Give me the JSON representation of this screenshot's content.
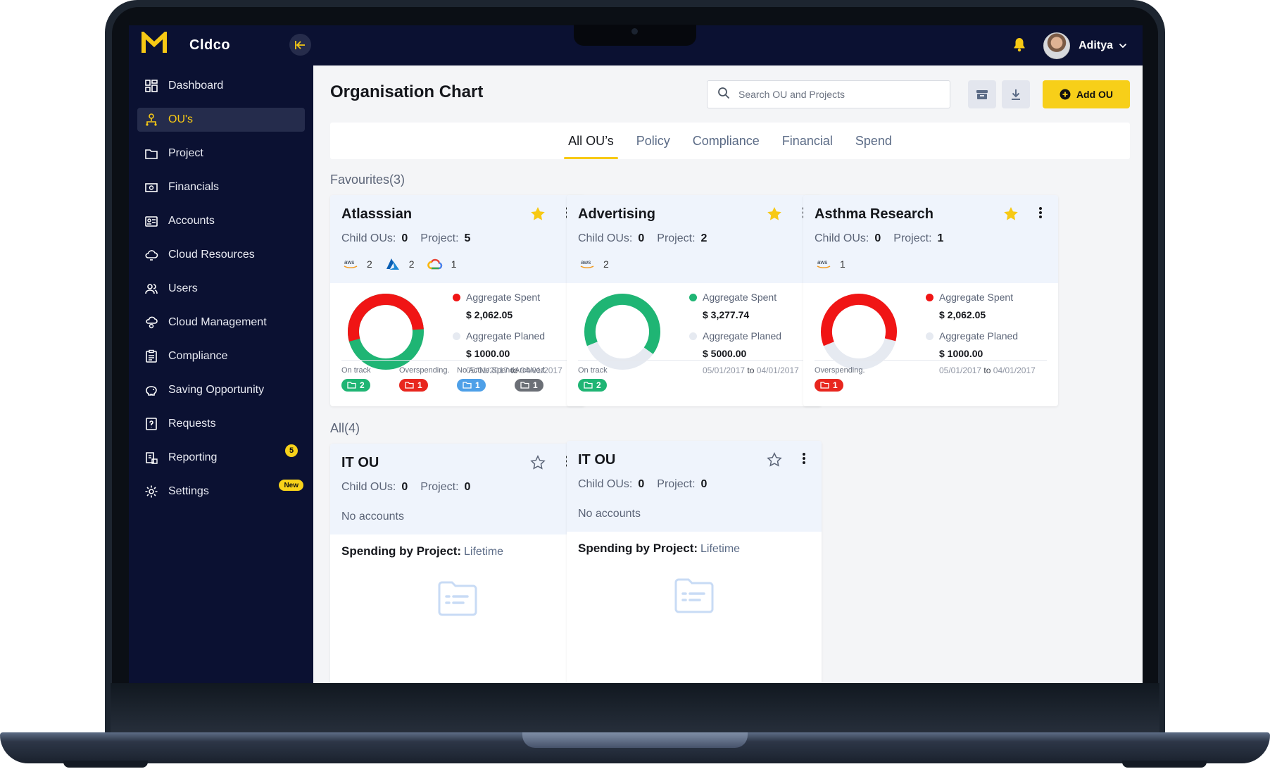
{
  "app": {
    "name": "Cldco",
    "user": "Aditya"
  },
  "nav": [
    {
      "label": "Dashboard",
      "icon": "dashboard-icon"
    },
    {
      "label": "OU's",
      "icon": "org-icon",
      "active": true
    },
    {
      "label": "Project",
      "icon": "folder-icon"
    },
    {
      "label": "Financials",
      "icon": "money-icon"
    },
    {
      "label": "Accounts",
      "icon": "accounts-icon"
    },
    {
      "label": "Cloud Resources",
      "icon": "cloud-icon"
    },
    {
      "label": "Users",
      "icon": "users-icon"
    },
    {
      "label": "Cloud Management",
      "icon": "cloud-gear-icon"
    },
    {
      "label": "Compliance",
      "icon": "clipboard-icon"
    },
    {
      "label": "Saving Opportunity",
      "icon": "piggy-icon"
    },
    {
      "label": "Requests",
      "icon": "request-icon"
    },
    {
      "label": "Reporting",
      "icon": "report-icon",
      "badge": "5"
    },
    {
      "label": "Settings",
      "icon": "gear-icon",
      "badge": "New"
    }
  ],
  "page": {
    "title": "Organisation Chart",
    "search_placeholder": "Search OU and Projects",
    "add_label": "Add OU",
    "tabs": [
      "All OU’s",
      "Policy",
      "Compliance",
      "Financial",
      "Spend"
    ],
    "favourites_label": "Favourites(3)",
    "all_label": "All(4)"
  },
  "labels": {
    "child_ous": "Child OUs:",
    "project": "Project:",
    "aggregate_spent": "Aggregate Spent",
    "aggregate_planed": "Aggregate Planed",
    "to": "to",
    "no_accounts": "No accounts",
    "spending_by_project": "Spending by Project:",
    "lifetime": "Lifetime"
  },
  "favourites": [
    {
      "name": "Atlasssian",
      "child_ous": "0",
      "projects": "5",
      "providers": [
        {
          "icon": "aws-icon",
          "count": "2"
        },
        {
          "icon": "azure-icon",
          "count": "2"
        },
        {
          "icon": "gcp-icon",
          "count": "1"
        }
      ],
      "spent": "$ 2,062.05",
      "planned": "$ 1000.00",
      "date_from": "05/01/2017",
      "date_to": "04/01/2017",
      "spent_color": "#f01515",
      "donut_pct": 1.0,
      "donut_color": "#1fb574",
      "overflow_color": "#f01515",
      "stats": [
        {
          "label": "On track",
          "count": "2",
          "color": "#1fb574"
        },
        {
          "label": "Overspending.",
          "count": "1",
          "color": "#e8261e"
        },
        {
          "label": "No Active Spend",
          "count": "1",
          "color": "#4ea0e8"
        },
        {
          "label": "Archived.",
          "count": "1",
          "color": "#6b6f76"
        }
      ]
    },
    {
      "name": "Advertising",
      "child_ous": "0",
      "projects": "2",
      "providers": [
        {
          "icon": "aws-icon",
          "count": "2"
        }
      ],
      "spent": "$ 3,277.74",
      "planned": "$ 5000.00",
      "date_from": "05/01/2017",
      "date_to": "04/01/2017",
      "spent_color": "#1fb574",
      "donut_pct": 0.66,
      "donut_color": "#1fb574",
      "stats": [
        {
          "label": "On track",
          "count": "2",
          "color": "#1fb574"
        }
      ]
    },
    {
      "name": "Asthma Research",
      "child_ous": "0",
      "projects": "1",
      "providers": [
        {
          "icon": "aws-icon",
          "count": "1"
        }
      ],
      "spent": "$ 2,062.05",
      "planned": "$ 1000.00",
      "date_from": "05/01/2017",
      "date_to": "04/01/2017",
      "spent_color": "#f01515",
      "donut_pct": 0.6,
      "donut_color": "#f01515",
      "stats": [
        {
          "label": "Overspending.",
          "count": "1",
          "color": "#e8261e"
        }
      ]
    }
  ],
  "all": [
    {
      "name": "IT OU",
      "child_ous": "0",
      "projects": "0"
    },
    {
      "name": "IT OU",
      "child_ous": "0",
      "projects": "0"
    }
  ]
}
